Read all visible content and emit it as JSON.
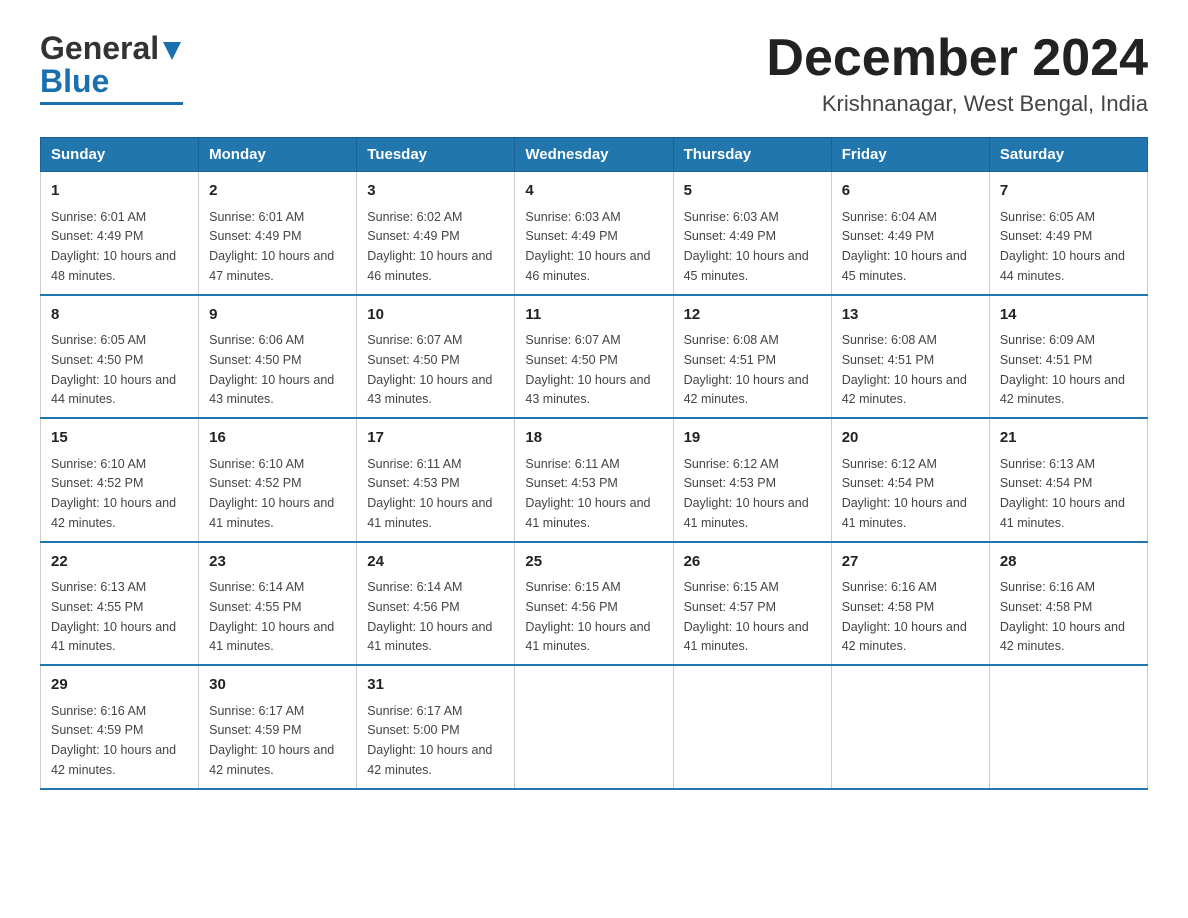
{
  "header": {
    "logo_text_general": "General",
    "logo_text_blue": "Blue",
    "month": "December 2024",
    "location": "Krishnanagar, West Bengal, India"
  },
  "days_of_week": [
    "Sunday",
    "Monday",
    "Tuesday",
    "Wednesday",
    "Thursday",
    "Friday",
    "Saturday"
  ],
  "weeks": [
    [
      {
        "day": "1",
        "sunrise": "6:01 AM",
        "sunset": "4:49 PM",
        "daylight": "10 hours and 48 minutes."
      },
      {
        "day": "2",
        "sunrise": "6:01 AM",
        "sunset": "4:49 PM",
        "daylight": "10 hours and 47 minutes."
      },
      {
        "day": "3",
        "sunrise": "6:02 AM",
        "sunset": "4:49 PM",
        "daylight": "10 hours and 46 minutes."
      },
      {
        "day": "4",
        "sunrise": "6:03 AM",
        "sunset": "4:49 PM",
        "daylight": "10 hours and 46 minutes."
      },
      {
        "day": "5",
        "sunrise": "6:03 AM",
        "sunset": "4:49 PM",
        "daylight": "10 hours and 45 minutes."
      },
      {
        "day": "6",
        "sunrise": "6:04 AM",
        "sunset": "4:49 PM",
        "daylight": "10 hours and 45 minutes."
      },
      {
        "day": "7",
        "sunrise": "6:05 AM",
        "sunset": "4:49 PM",
        "daylight": "10 hours and 44 minutes."
      }
    ],
    [
      {
        "day": "8",
        "sunrise": "6:05 AM",
        "sunset": "4:50 PM",
        "daylight": "10 hours and 44 minutes."
      },
      {
        "day": "9",
        "sunrise": "6:06 AM",
        "sunset": "4:50 PM",
        "daylight": "10 hours and 43 minutes."
      },
      {
        "day": "10",
        "sunrise": "6:07 AM",
        "sunset": "4:50 PM",
        "daylight": "10 hours and 43 minutes."
      },
      {
        "day": "11",
        "sunrise": "6:07 AM",
        "sunset": "4:50 PM",
        "daylight": "10 hours and 43 minutes."
      },
      {
        "day": "12",
        "sunrise": "6:08 AM",
        "sunset": "4:51 PM",
        "daylight": "10 hours and 42 minutes."
      },
      {
        "day": "13",
        "sunrise": "6:08 AM",
        "sunset": "4:51 PM",
        "daylight": "10 hours and 42 minutes."
      },
      {
        "day": "14",
        "sunrise": "6:09 AM",
        "sunset": "4:51 PM",
        "daylight": "10 hours and 42 minutes."
      }
    ],
    [
      {
        "day": "15",
        "sunrise": "6:10 AM",
        "sunset": "4:52 PM",
        "daylight": "10 hours and 42 minutes."
      },
      {
        "day": "16",
        "sunrise": "6:10 AM",
        "sunset": "4:52 PM",
        "daylight": "10 hours and 41 minutes."
      },
      {
        "day": "17",
        "sunrise": "6:11 AM",
        "sunset": "4:53 PM",
        "daylight": "10 hours and 41 minutes."
      },
      {
        "day": "18",
        "sunrise": "6:11 AM",
        "sunset": "4:53 PM",
        "daylight": "10 hours and 41 minutes."
      },
      {
        "day": "19",
        "sunrise": "6:12 AM",
        "sunset": "4:53 PM",
        "daylight": "10 hours and 41 minutes."
      },
      {
        "day": "20",
        "sunrise": "6:12 AM",
        "sunset": "4:54 PM",
        "daylight": "10 hours and 41 minutes."
      },
      {
        "day": "21",
        "sunrise": "6:13 AM",
        "sunset": "4:54 PM",
        "daylight": "10 hours and 41 minutes."
      }
    ],
    [
      {
        "day": "22",
        "sunrise": "6:13 AM",
        "sunset": "4:55 PM",
        "daylight": "10 hours and 41 minutes."
      },
      {
        "day": "23",
        "sunrise": "6:14 AM",
        "sunset": "4:55 PM",
        "daylight": "10 hours and 41 minutes."
      },
      {
        "day": "24",
        "sunrise": "6:14 AM",
        "sunset": "4:56 PM",
        "daylight": "10 hours and 41 minutes."
      },
      {
        "day": "25",
        "sunrise": "6:15 AM",
        "sunset": "4:56 PM",
        "daylight": "10 hours and 41 minutes."
      },
      {
        "day": "26",
        "sunrise": "6:15 AM",
        "sunset": "4:57 PM",
        "daylight": "10 hours and 41 minutes."
      },
      {
        "day": "27",
        "sunrise": "6:16 AM",
        "sunset": "4:58 PM",
        "daylight": "10 hours and 42 minutes."
      },
      {
        "day": "28",
        "sunrise": "6:16 AM",
        "sunset": "4:58 PM",
        "daylight": "10 hours and 42 minutes."
      }
    ],
    [
      {
        "day": "29",
        "sunrise": "6:16 AM",
        "sunset": "4:59 PM",
        "daylight": "10 hours and 42 minutes."
      },
      {
        "day": "30",
        "sunrise": "6:17 AM",
        "sunset": "4:59 PM",
        "daylight": "10 hours and 42 minutes."
      },
      {
        "day": "31",
        "sunrise": "6:17 AM",
        "sunset": "5:00 PM",
        "daylight": "10 hours and 42 minutes."
      },
      null,
      null,
      null,
      null
    ]
  ]
}
